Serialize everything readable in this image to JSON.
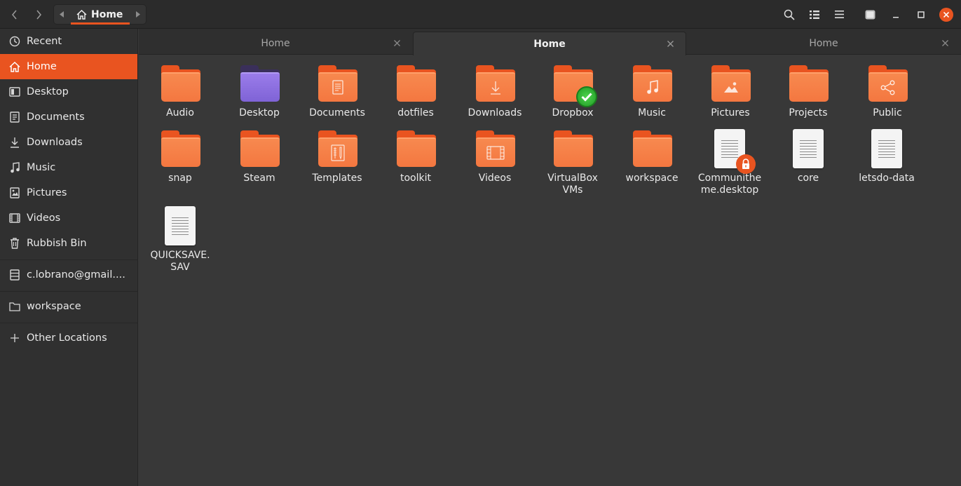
{
  "header": {
    "path_label": "Home"
  },
  "sidebar": {
    "items": [
      {
        "label": "Recent",
        "icon": "clock-icon"
      },
      {
        "label": "Home",
        "icon": "home-icon"
      },
      {
        "label": "Desktop",
        "icon": "desktop-icon"
      },
      {
        "label": "Documents",
        "icon": "document-icon"
      },
      {
        "label": "Downloads",
        "icon": "download-icon"
      },
      {
        "label": "Music",
        "icon": "music-icon"
      },
      {
        "label": "Pictures",
        "icon": "picture-icon"
      },
      {
        "label": "Videos",
        "icon": "video-icon"
      },
      {
        "label": "Rubbish Bin",
        "icon": "trash-icon"
      },
      {
        "label": "c.lobrano@gmail....",
        "icon": "drive-icon"
      },
      {
        "label": "workspace",
        "icon": "folder-icon"
      },
      {
        "label": "Other Locations",
        "icon": "plus-icon"
      }
    ],
    "active_index": 1
  },
  "tabs": [
    {
      "label": "Home",
      "active": false
    },
    {
      "label": "Home",
      "active": true
    },
    {
      "label": "Home",
      "active": false
    }
  ],
  "files": [
    {
      "name": "Audio",
      "kind": "folder",
      "emblem": ""
    },
    {
      "name": "Desktop",
      "kind": "folder-desktop",
      "emblem": ""
    },
    {
      "name": "Documents",
      "kind": "folder",
      "emblem": "document-icon"
    },
    {
      "name": "dotfiles",
      "kind": "folder",
      "emblem": ""
    },
    {
      "name": "Downloads",
      "kind": "folder",
      "emblem": "download-icon"
    },
    {
      "name": "Dropbox",
      "kind": "folder",
      "emblem": "check-badge"
    },
    {
      "name": "Music",
      "kind": "folder",
      "emblem": "music-note-icon"
    },
    {
      "name": "Pictures",
      "kind": "folder",
      "emblem": "picture-icon"
    },
    {
      "name": "Projects",
      "kind": "folder",
      "emblem": ""
    },
    {
      "name": "Public",
      "kind": "folder",
      "emblem": "share-icon"
    },
    {
      "name": "snap",
      "kind": "folder",
      "emblem": ""
    },
    {
      "name": "Steam",
      "kind": "folder",
      "emblem": ""
    },
    {
      "name": "Templates",
      "kind": "folder",
      "emblem": "template-icon"
    },
    {
      "name": "toolkit",
      "kind": "folder",
      "emblem": ""
    },
    {
      "name": "Videos",
      "kind": "folder",
      "emblem": "film-icon"
    },
    {
      "name": "VirtualBox VMs",
      "kind": "folder",
      "emblem": ""
    },
    {
      "name": "workspace",
      "kind": "folder",
      "emblem": ""
    },
    {
      "name": "Communitheme.desktop",
      "kind": "document",
      "emblem": "lock-badge"
    },
    {
      "name": "core",
      "kind": "document",
      "emblem": ""
    },
    {
      "name": "letsdo-data",
      "kind": "document",
      "emblem": ""
    },
    {
      "name": "QUICKSAVE.SAV",
      "kind": "document",
      "emblem": ""
    }
  ],
  "colors": {
    "accent": "#e95420",
    "folder": "#f47740",
    "background": "#383838",
    "sidebar": "#303030"
  }
}
